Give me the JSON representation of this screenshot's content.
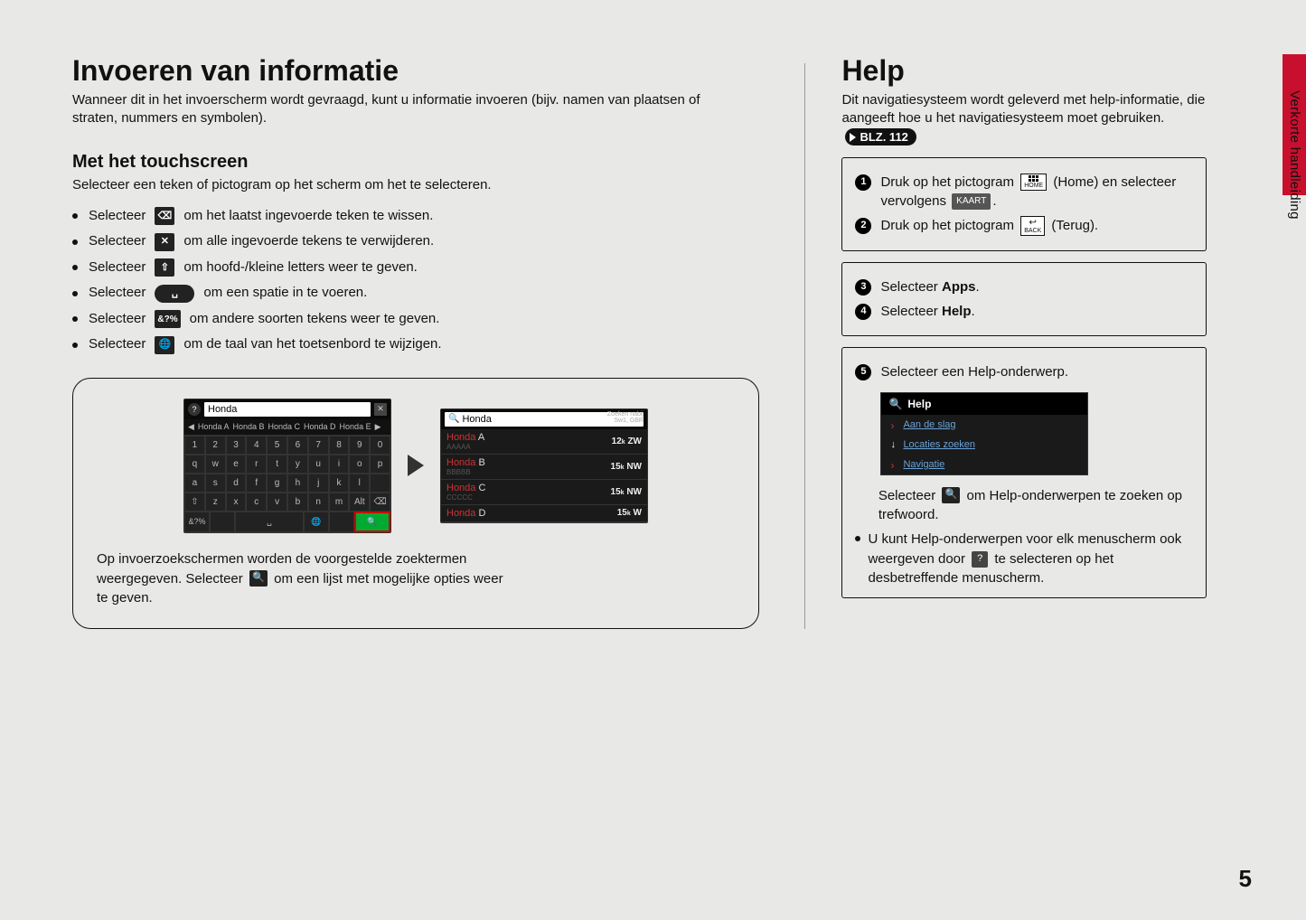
{
  "sideTab": {
    "label": "Verkorte handleiding"
  },
  "pageNumber": "5",
  "left": {
    "title": "Invoeren van informatie",
    "intro": "Wanneer dit in het invoerscherm wordt gevraagd, kunt u informatie invoeren (bijv. namen van plaatsen of straten, nummers en symbolen).",
    "subheading": "Met het touchscreen",
    "subintro": "Selecteer een teken of pictogram op het scherm om het te selecteren.",
    "bullets": [
      {
        "pre": "Selecteer",
        "icon": "backspace-icon",
        "text": "om het laatst ingevoerde teken te wissen."
      },
      {
        "pre": "Selecteer",
        "icon": "clear-icon",
        "text": "om alle ingevoerde tekens te verwijderen."
      },
      {
        "pre": "Selecteer",
        "icon": "shift-icon",
        "text": "om hoofd-/kleine letters weer te geven."
      },
      {
        "pre": "Selecteer",
        "icon": "space-icon",
        "text": "om een spatie in te voeren."
      },
      {
        "pre": "Selecteer",
        "icon": "symbols-icon",
        "text": "om andere soorten tekens weer te geven."
      },
      {
        "pre": "Selecteer",
        "icon": "globe-icon",
        "text": "om de taal van het toetsenbord te wijzigen."
      }
    ],
    "iconGlyphs": {
      "backspace-icon": "⌫",
      "clear-icon": "✕",
      "shift-icon": "⇧",
      "space-icon": "␣",
      "symbols-icon": "&?%",
      "globe-icon": "🌐"
    },
    "keyboardScreenshot": {
      "searchValue": "Honda",
      "suggestions": [
        "Honda A",
        "Honda B",
        "Honda C",
        "Honda D",
        "Honda E"
      ],
      "row1": [
        "1",
        "2",
        "3",
        "4",
        "5",
        "6",
        "7",
        "8",
        "9",
        "0"
      ],
      "row2": [
        "q",
        "w",
        "e",
        "r",
        "t",
        "y",
        "u",
        "i",
        "o",
        "p"
      ],
      "row3": [
        "a",
        "s",
        "d",
        "f",
        "g",
        "h",
        "j",
        "k",
        "l",
        ""
      ],
      "row4": [
        "⇧",
        "z",
        "x",
        "c",
        "v",
        "b",
        "n",
        "m",
        "Alt",
        "⌫"
      ],
      "bottom": {
        "symbols": "&?%",
        "space": "␣",
        "globe": "🌐",
        "search": "🔍"
      }
    },
    "resultsScreenshot": {
      "searchValue": "Honda",
      "cornerLabel": "Zoeken nabij\nSw1, GBR",
      "rows": [
        {
          "name": "Honda A",
          "sub": "AAAAA",
          "dist": "12",
          "unit": "ZW"
        },
        {
          "name": "Honda B",
          "sub": "BBBBB",
          "dist": "15",
          "unit": "NW"
        },
        {
          "name": "Honda C",
          "sub": "CCCCC",
          "dist": "15",
          "unit": "NW"
        },
        {
          "name": "Honda D",
          "sub": "",
          "dist": "15",
          "unit": "W"
        }
      ]
    },
    "caption": {
      "line1": "Op invoerzoekschermen worden de voorgestelde zoektermen",
      "line2a": "weergegeven. Selecteer",
      "line2b": "om een lijst met mogelijke opties weer",
      "line3": "te geven."
    }
  },
  "right": {
    "title": "Help",
    "intro": "Dit navigatiesysteem wordt geleverd met help-informatie, die aangeeft hoe u het navigatiesysteem moet gebruiken.",
    "pageRef": "BLZ. 112",
    "box1": {
      "step1": {
        "pre": "Druk op het pictogram",
        "homeLabel": "HOME",
        "mid": "(Home) en selecteer vervolgens",
        "kaart": "KAART",
        "post": "."
      },
      "step2": {
        "pre": "Druk op het pictogram",
        "backLabel": "BACK",
        "post": "(Terug)."
      }
    },
    "box2": {
      "step3": {
        "pre": "Selecteer",
        "bold": "Apps",
        "post": "."
      },
      "step4": {
        "pre": "Selecteer",
        "bold": "Help",
        "post": "."
      }
    },
    "box3": {
      "step5": "Selecteer een Help-onderwerp.",
      "helpShot": {
        "title": "Help",
        "items": [
          "Aan de slag",
          "Locaties zoeken",
          "Navigatie"
        ]
      },
      "afterPre": "Selecteer",
      "afterPost": "om Help-onderwerpen te zoeken op trefwoord.",
      "bullet": "U kunt Help-onderwerpen voor elk menuscherm ook weergeven door",
      "bulletMid": "te selecteren op het desbetreffende menuscherm."
    }
  }
}
